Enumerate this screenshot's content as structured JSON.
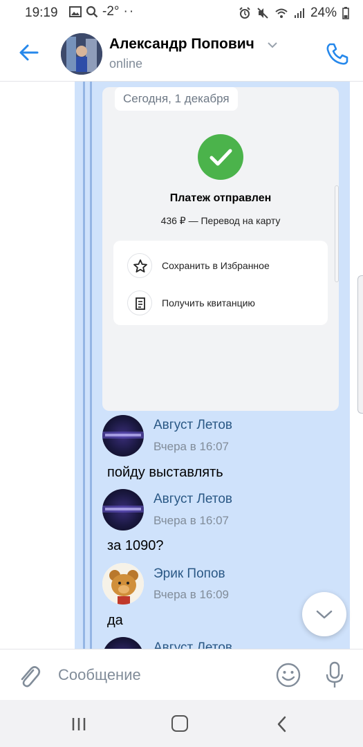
{
  "status_bar": {
    "time": "19:19",
    "temp": "-2°",
    "battery": "24%"
  },
  "header": {
    "title": "Александр Попович",
    "subtitle": "online"
  },
  "payment_card": {
    "date": "Сегодня, 1 декабря",
    "title": "Платеж отправлен",
    "subtitle": "436 ₽ — Перевод на карту",
    "action_save": "Сохранить в Избранное",
    "action_receipt": "Получить квитанцию",
    "status_color": "#4bb34b"
  },
  "messages": [
    {
      "author": "Август Летов",
      "time": "Вчера в 16:07",
      "text": "пойду выставлять"
    },
    {
      "author": "Август Летов",
      "time": "Вчера в 16:07",
      "text": "за 1090?"
    },
    {
      "author": "Эрик Попов",
      "time": "Вчера в 16:09",
      "text": "да"
    },
    {
      "author": "Август Летов"
    }
  ],
  "composer": {
    "placeholder": "Сообщение"
  },
  "colors": {
    "accent": "#2688eb",
    "selection": "#cfe2fb",
    "author": "#2a5885"
  }
}
